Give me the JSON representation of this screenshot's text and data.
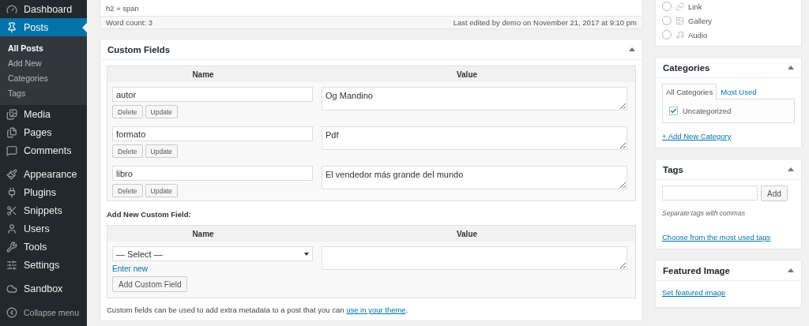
{
  "sidebar": {
    "items": [
      {
        "label": "Dashboard",
        "selected": false
      },
      {
        "label": "Posts",
        "selected": true,
        "children": [
          {
            "label": "All Posts",
            "selected": true
          },
          {
            "label": "Add New",
            "selected": false
          },
          {
            "label": "Categories",
            "selected": false
          },
          {
            "label": "Tags",
            "selected": false
          }
        ]
      },
      {
        "label": "Media",
        "selected": false
      },
      {
        "label": "Pages",
        "selected": false
      },
      {
        "label": "Comments",
        "selected": false
      },
      {
        "label": "Appearance",
        "selected": false
      },
      {
        "label": "Plugins",
        "selected": false
      },
      {
        "label": "Snippets",
        "selected": false
      },
      {
        "label": "Users",
        "selected": false
      },
      {
        "label": "Tools",
        "selected": false
      },
      {
        "label": "Settings",
        "selected": false
      },
      {
        "label": "Sandbox",
        "selected": false
      }
    ],
    "collapse": "Collapse menu"
  },
  "editor_status": {
    "path": "h2 » span",
    "word_count": "Word count: 3",
    "last_edited": "Last edited by demo on November 21, 2017 at 9:10 pm"
  },
  "custom_fields": {
    "title": "Custom Fields",
    "columns": [
      "Name",
      "Value"
    ],
    "rows": [
      {
        "name": "autor",
        "value": "Og Mandino",
        "buttons": [
          "Delete",
          "Update"
        ]
      },
      {
        "name": "formato",
        "value": "Pdf",
        "buttons": [
          "Delete",
          "Update"
        ]
      },
      {
        "name": "libro",
        "value": "El vendedor más grande del mundo",
        "buttons": [
          "Delete",
          "Update"
        ]
      }
    ],
    "add_new": {
      "heading": "Add New Custom Field:",
      "columns": [
        "Name",
        "Value"
      ],
      "select": "— Select —",
      "link": "Enter new",
      "button": "Add Custom Field"
    },
    "note": {
      "text": "Custom fields can be used to add extra metadata to a post that you can ",
      "link": "use in your theme",
      "end": "."
    }
  },
  "format": {
    "options": [
      {
        "label": "Link",
        "selected": false
      },
      {
        "label": "Gallery",
        "selected": false
      },
      {
        "label": "Audio",
        "selected": false
      }
    ]
  },
  "categories": {
    "title": "Categories",
    "tabs": [
      {
        "label": "All Categories",
        "selected": true
      },
      {
        "label": "Most Used",
        "selected": false
      }
    ],
    "items": [
      {
        "label": "Uncategorized",
        "checked": true
      }
    ],
    "add_link": "+ Add New Category"
  },
  "tags": {
    "title": "Tags",
    "button": "Add",
    "hint": "Separate tags with commas",
    "link": "Choose from the most used tags"
  },
  "featured_image": {
    "title": "Featured Image",
    "link": "Set featured image"
  }
}
